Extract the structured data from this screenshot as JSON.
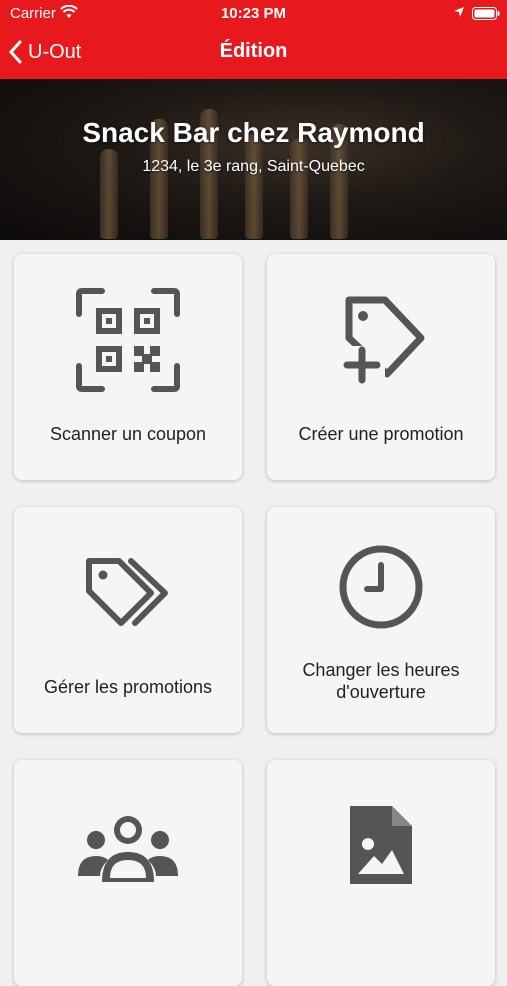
{
  "status_bar": {
    "carrier": "Carrier",
    "time": "10:23 PM"
  },
  "nav": {
    "back_label": "U-Out",
    "title": "Édition"
  },
  "venue": {
    "name": "Snack Bar chez Raymond",
    "address": "1234, le 3e rang, Saint-Quebec"
  },
  "actions": [
    {
      "label": "Scanner un coupon",
      "icon": "qr-code-icon"
    },
    {
      "label": "Créer une promotion",
      "icon": "tag-plus-icon"
    },
    {
      "label": "Gérer les promotions",
      "icon": "tags-icon"
    },
    {
      "label": "Changer les heures d'ouverture",
      "icon": "clock-icon"
    },
    {
      "label": "",
      "icon": "users-icon"
    },
    {
      "label": "",
      "icon": "image-file-icon"
    }
  ],
  "colors": {
    "brand_red": "#e8191c",
    "icon_gray": "#555555",
    "card_bg": "#f5f5f5",
    "page_bg": "#f0f0f0"
  }
}
